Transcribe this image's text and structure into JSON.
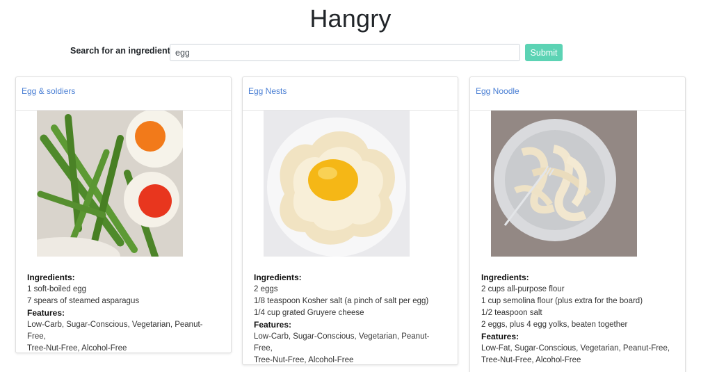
{
  "app": {
    "title": "Hangry"
  },
  "search": {
    "label": "Search for an ingredient:",
    "value": "egg",
    "submit_label": "Submit"
  },
  "colors": {
    "accent": "#5cd3b4",
    "link": "#4a7fd4"
  },
  "recipes": [
    {
      "title": "Egg & soldiers",
      "image": "soft-boiled-eggs-with-asparagus-photo",
      "ingredients_heading": "Ingredients:",
      "ingredients": [
        "1 soft-boiled egg",
        "7 spears of steamed asparagus"
      ],
      "features_heading": "Features:",
      "features": [
        "Low-Carb, Sugar-Conscious, Vegetarian, Peanut-Free,",
        "Tree-Nut-Free, Alcohol-Free"
      ]
    },
    {
      "title": "Egg Nests",
      "image": "egg-cloud-nest-photo",
      "ingredients_heading": "Ingredients:",
      "ingredients": [
        "2 eggs",
        "1/8 teaspoon Kosher salt (a pinch of salt per egg)",
        "1/4 cup grated Gruyere cheese"
      ],
      "features_heading": "Features:",
      "features": [
        "Low-Carb, Sugar-Conscious, Vegetarian, Peanut-Free,",
        "Tree-Nut-Free, Alcohol-Free"
      ]
    },
    {
      "title": "Egg Noodle",
      "image": "egg-noodles-plate-photo",
      "ingredients_heading": "Ingredients:",
      "ingredients": [
        "2 cups all-purpose flour",
        "1 cup semolina flour (plus extra for the board)",
        "1/2 teaspoon salt",
        "2 eggs, plus 4 egg yolks, beaten together"
      ],
      "features_heading": "Features:",
      "features": [
        "Low-Fat, Sugar-Conscious, Vegetarian, Peanut-Free,",
        "Tree-Nut-Free, Alcohol-Free"
      ]
    }
  ]
}
